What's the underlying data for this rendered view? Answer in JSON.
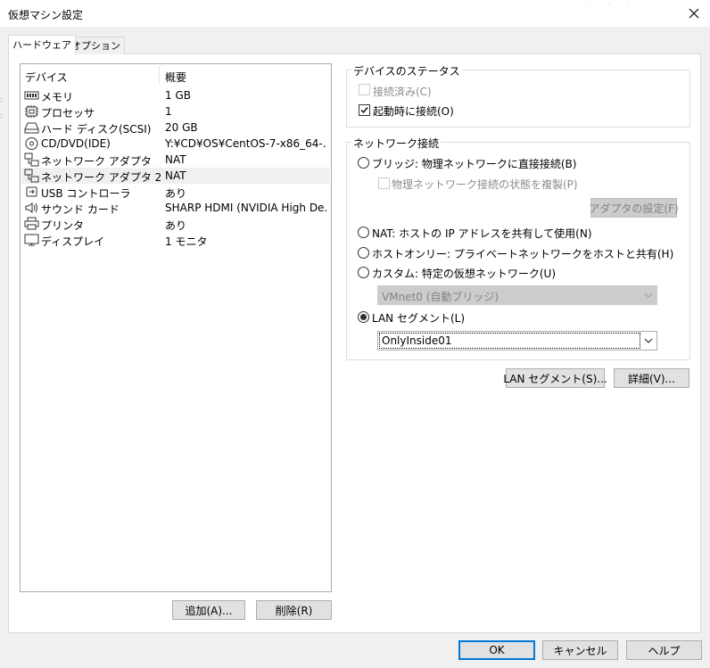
{
  "window": {
    "title": "仮想マシン設定"
  },
  "tabs": [
    {
      "label": "ハードウェア",
      "active": true
    },
    {
      "label": "オプション",
      "active": false
    }
  ],
  "device_list": {
    "columns": [
      "デバイス",
      "概要"
    ],
    "rows": [
      {
        "icon": "memory-icon",
        "name": "メモリ",
        "summary": "1 GB"
      },
      {
        "icon": "processor-icon",
        "name": "プロセッサ",
        "summary": "1"
      },
      {
        "icon": "hard-disk-icon",
        "name": "ハード ディスク(SCSI)",
        "summary": "20 GB"
      },
      {
        "icon": "cd-dvd-icon",
        "name": "CD/DVD(IDE)",
        "summary": "Y:¥CD¥OS¥CentOS-7-x86_64-..."
      },
      {
        "icon": "network-adapter-icon",
        "name": "ネットワーク アダプタ",
        "summary": "NAT"
      },
      {
        "icon": "network-adapter-icon",
        "name": "ネットワーク アダプタ 2",
        "summary": "NAT",
        "selected": true
      },
      {
        "icon": "usb-icon",
        "name": "USB コントローラ",
        "summary": "あり"
      },
      {
        "icon": "sound-card-icon",
        "name": "サウンド カード",
        "summary": "SHARP HDMI (NVIDIA High De..."
      },
      {
        "icon": "printer-icon",
        "name": "プリンタ",
        "summary": "あり"
      },
      {
        "icon": "display-icon",
        "name": "ディスプレイ",
        "summary": "1 モニタ"
      }
    ]
  },
  "list_buttons": {
    "add": "追加(A)...",
    "remove": "削除(R)"
  },
  "device_status": {
    "title": "デバイスのステータス",
    "connected": {
      "label": "接続済み(C)",
      "checked": false,
      "enabled": false
    },
    "connect_at_power_on": {
      "label": "起動時に接続(O)",
      "checked": true,
      "enabled": true
    }
  },
  "network_connection": {
    "title": "ネットワーク接続",
    "bridged": {
      "label": "ブリッジ: 物理ネットワークに直接接続(B)",
      "selected": false
    },
    "replicate": {
      "label": "物理ネットワーク接続の状態を複製(P)",
      "checked": false,
      "enabled": false
    },
    "configure_adapters": "アダプタの設定(F)",
    "nat": {
      "label": "NAT: ホストの IP アドレスを共有して使用(N)",
      "selected": false
    },
    "host_only": {
      "label": "ホストオンリー: プライベートネットワークをホストと共有(H)",
      "selected": false
    },
    "custom": {
      "label": "カスタム: 特定の仮想ネットワーク(U)",
      "selected": false
    },
    "custom_network_value": "VMnet0 (自動ブリッジ)",
    "lan_segment": {
      "label": "LAN セグメント(L)",
      "selected": true
    },
    "lan_segment_value": "OnlyInside01"
  },
  "right_buttons": {
    "lan_segments": "LAN セグメント(S)...",
    "advanced": "詳細(V)..."
  },
  "footer": {
    "ok": "OK",
    "cancel": "キャンセル",
    "help": "ヘルプ"
  },
  "colors": {
    "focus_blue": "#0078d7",
    "panel_bg": "#ffffff",
    "dialog_bg": "#f0f0f0"
  }
}
